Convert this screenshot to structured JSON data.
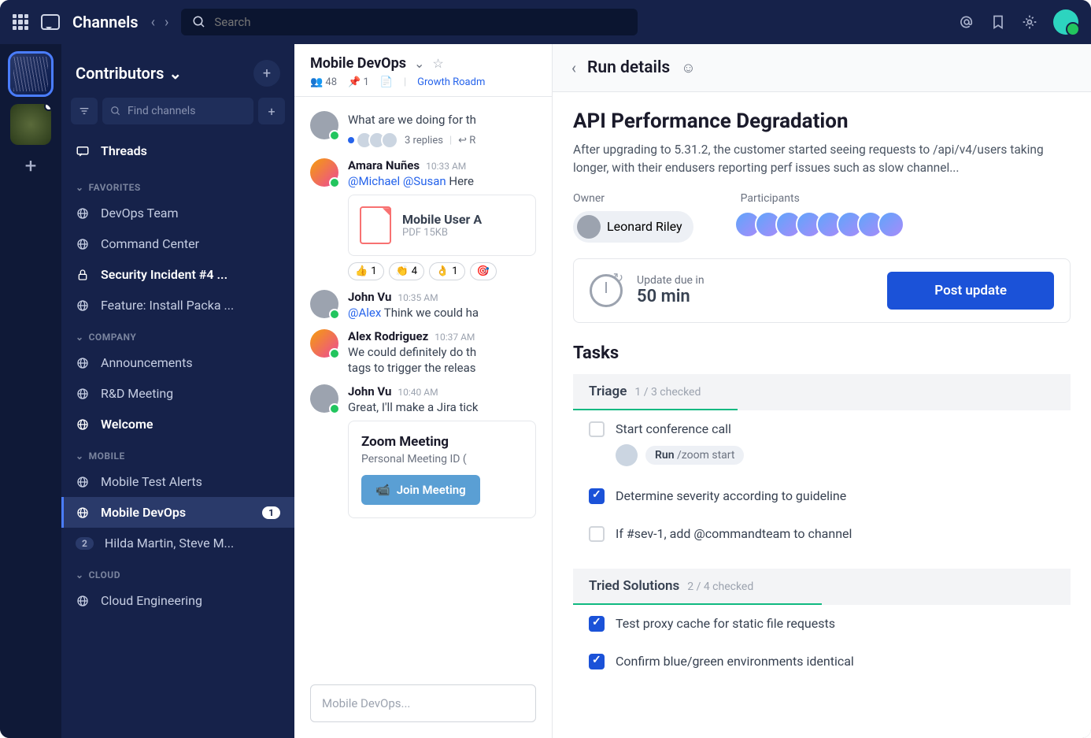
{
  "topbar": {
    "title": "Channels",
    "search_placeholder": "Search"
  },
  "sidebar": {
    "team_name": "Contributors",
    "find_placeholder": "Find channels",
    "threads_label": "Threads",
    "sections": {
      "favorites": {
        "label": "FAVORITES",
        "items": [
          {
            "label": "DevOps Team",
            "icon": "globe"
          },
          {
            "label": "Command Center",
            "icon": "globe"
          },
          {
            "label": "Security Incident #4 ...",
            "icon": "lock",
            "bold": true
          },
          {
            "label": "Feature: Install Packa ...",
            "icon": "globe"
          }
        ]
      },
      "company": {
        "label": "COMPANY",
        "items": [
          {
            "label": "Announcements",
            "icon": "globe"
          },
          {
            "label": "R&D Meeting",
            "icon": "globe"
          },
          {
            "label": "Welcome",
            "icon": "globe",
            "bold": true
          }
        ]
      },
      "mobile": {
        "label": "MOBILE",
        "items": [
          {
            "label": "Mobile Test Alerts",
            "icon": "globe"
          },
          {
            "label": "Mobile DevOps",
            "icon": "globe",
            "active": true,
            "badge": "1"
          },
          {
            "label": "Hilda Martin, Steve M...",
            "icon": "dm",
            "badge_gray": "2"
          }
        ]
      },
      "cloud": {
        "label": "CLOUD",
        "items": [
          {
            "label": "Cloud Engineering",
            "icon": "globe"
          }
        ]
      }
    }
  },
  "channel": {
    "name": "Mobile DevOps",
    "members": "48",
    "pins": "1",
    "link": "Growth Roadm",
    "compose_placeholder": "Mobile DevOps...",
    "messages": [
      {
        "author": "",
        "text": "What are we doing for th",
        "replies_count": "3 replies",
        "replies_reply": "R"
      },
      {
        "author": "Amara Nuñes",
        "time": "10:33 AM",
        "mention1": "@Michael",
        "mention2": "@Susan",
        "text": " Here",
        "attachment_name": "Mobile User A",
        "attachment_meta": "PDF 15KB",
        "reactions": [
          {
            "emoji": "👍",
            "n": "1"
          },
          {
            "emoji": "👏",
            "n": "4"
          },
          {
            "emoji": "👌",
            "n": "1"
          },
          {
            "emoji": "🎯",
            "n": ""
          }
        ]
      },
      {
        "author": "John Vu",
        "time": "10:35 AM",
        "mention1": "@Alex",
        "text": " Think we could ha"
      },
      {
        "author": "Alex Rodriguez",
        "time": "10:37 AM",
        "text": "We could definitely do th",
        "text2": "tags to trigger the releas"
      },
      {
        "author": "John Vu",
        "time": "10:40 AM",
        "text": "Great, I'll make a Jira tick",
        "zoom_title": "Zoom Meeting",
        "zoom_sub": "Personal Meeting ID (",
        "zoom_btn": "Join Meeting"
      }
    ]
  },
  "run": {
    "header": "Run details",
    "title": "API Performance Degradation",
    "desc": "After upgrading to 5.31.2, the customer started seeing requests to /api/v4/users taking longer, with their endusers reporting perf issues such as slow channel...",
    "owner_label": "Owner",
    "owner_name": "Leonard Riley",
    "participants_label": "Participants",
    "participants_count": 8,
    "update_due_label": "Update due in",
    "update_due_time": "50 min",
    "post_btn": "Post update",
    "tasks_label": "Tasks",
    "sections": [
      {
        "name": "Triage",
        "count": "1 / 3 checked",
        "items": [
          {
            "label": "Start conference call",
            "checked": false,
            "run_cmd": "/zoom start",
            "run_label": "Run"
          },
          {
            "label": "Determine severity according to guideline",
            "checked": true
          },
          {
            "label": "If #sev-1, add @commandteam to channel",
            "checked": false
          }
        ]
      },
      {
        "name": "Tried Solutions",
        "count": "2 / 4 checked",
        "items": [
          {
            "label": "Test proxy cache for static file requests",
            "checked": true
          },
          {
            "label": "Confirm blue/green environments identical",
            "checked": true
          }
        ]
      }
    ]
  }
}
